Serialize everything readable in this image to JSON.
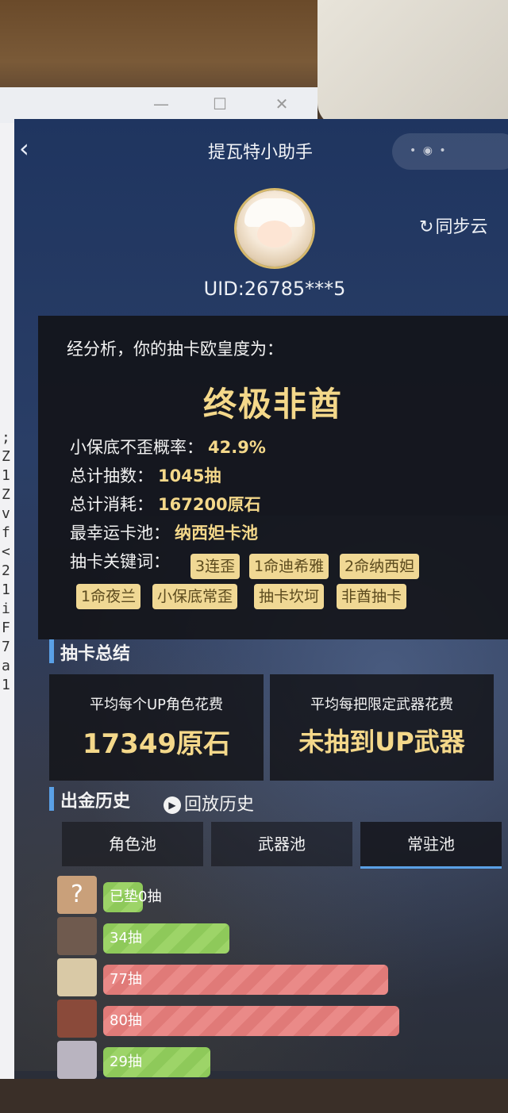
{
  "window": {
    "min_icon": "minimize-icon",
    "max_icon": "maximize-icon",
    "close_icon": "close-icon"
  },
  "header": {
    "title": "提瓦特小助手",
    "back_icon": "chevron-left-icon"
  },
  "profile": {
    "uid": "UID:26785***5",
    "sync_label": "同步云",
    "sync_icon": "refresh-icon"
  },
  "analysis": {
    "intro": "经分析，你的抽卡欧皇度为：",
    "verdict": "终极非酋",
    "stats": [
      {
        "label": "小保底不歪概率：",
        "value": "42.9%"
      },
      {
        "label": "总计抽数：",
        "value": "1045抽"
      },
      {
        "label": "总计消耗：",
        "value": "167200原石"
      },
      {
        "label": "最幸运卡池：",
        "value": "纳西妲卡池"
      }
    ],
    "keywords_label": "抽卡关键词：",
    "keywords": [
      "3连歪",
      "1命迪希雅",
      "2命纳西妲",
      "1命夜兰",
      "小保底常歪",
      "抽卡坎坷",
      "非酋抽卡"
    ]
  },
  "summary": {
    "title": "抽卡总结",
    "avg_char_label": "平均每个UP角色花费",
    "avg_char_value": "17349原石",
    "avg_weapon_label": "平均每把限定武器花费",
    "avg_weapon_value": "未抽到UP武器"
  },
  "history": {
    "title": "出金历史",
    "replay_label": "回放历史",
    "tabs": [
      "角色池",
      "武器池",
      "常驻池"
    ],
    "active_tab": "常驻池",
    "rows": [
      {
        "label": "已垫0抽",
        "pulls": 0,
        "status": "green",
        "avatar_icon": "question-icon"
      },
      {
        "label": "34抽",
        "pulls": 34,
        "status": "green",
        "avatar_icon": "character-avatar"
      },
      {
        "label": "77抽",
        "pulls": 77,
        "status": "red",
        "avatar_icon": "character-avatar"
      },
      {
        "label": "80抽",
        "pulls": 80,
        "status": "red",
        "avatar_icon": "character-avatar"
      },
      {
        "label": "29抽",
        "pulls": 29,
        "status": "green",
        "avatar_icon": "character-avatar"
      }
    ]
  },
  "colors": {
    "gold": "#f4d88a",
    "accent_blue": "#5aa0e6",
    "green_bar": "#8ec95a",
    "red_bar": "#e07a78"
  }
}
